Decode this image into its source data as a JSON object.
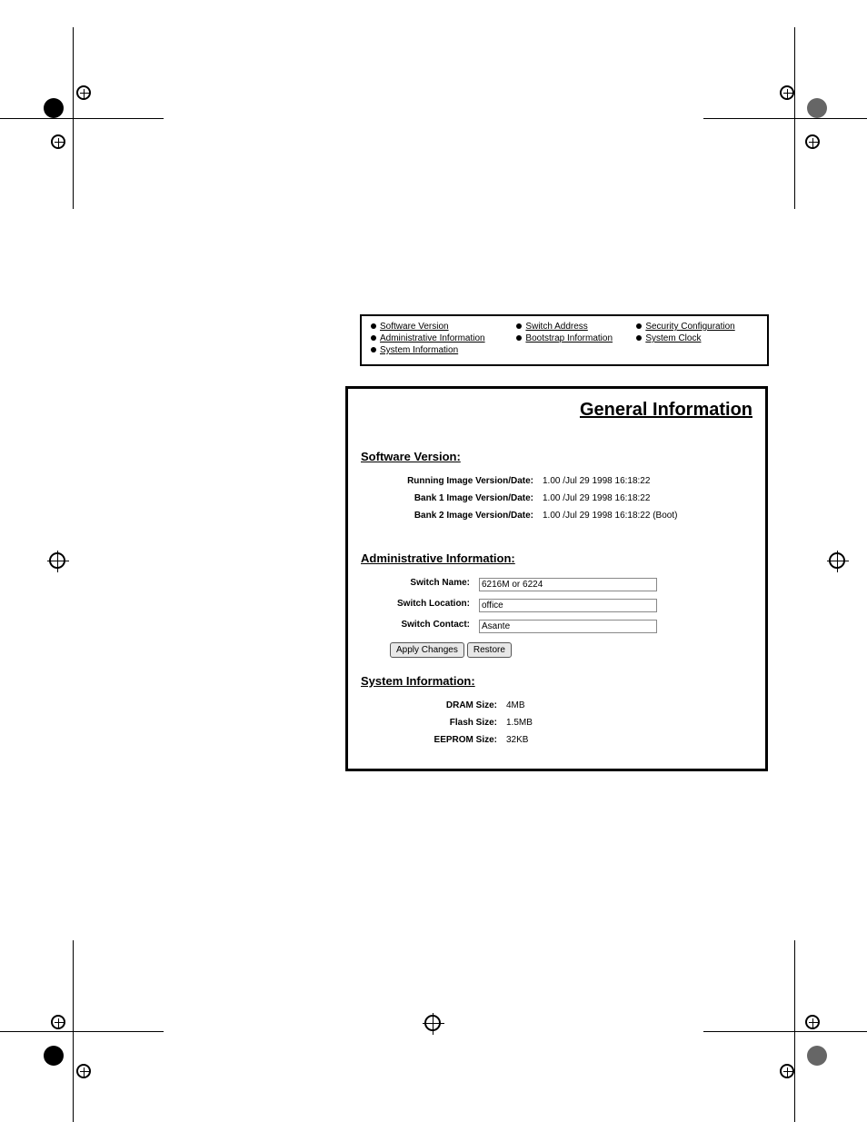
{
  "nav": {
    "col1": [
      "Software Version",
      "Administrative Information",
      "System Information"
    ],
    "col2": [
      "Switch Address",
      "Bootstrap Information"
    ],
    "col3": [
      "Security Configuration",
      "System Clock"
    ]
  },
  "panel": {
    "title": "General Information"
  },
  "software": {
    "heading": "Software Version:",
    "items": [
      {
        "label": "Running Image Version/Date:",
        "value": "1.00 /Jul 29 1998 16:18:22"
      },
      {
        "label": "Bank 1 Image Version/Date:",
        "value": "1.00 /Jul 29 1998 16:18:22"
      },
      {
        "label": "Bank 2 Image Version/Date:",
        "value": "1.00 /Jul 29 1998 16:18:22 (Boot)"
      }
    ]
  },
  "admin": {
    "heading": "Administrative Information:",
    "name_label": "Switch Name:",
    "name_value": "6216M or 6224",
    "location_label": "Switch Location:",
    "location_value": "office",
    "contact_label": "Switch Contact:",
    "contact_value": "Asante",
    "apply": "Apply Changes",
    "restore": "Restore"
  },
  "system": {
    "heading": "System Information:",
    "items": [
      {
        "label": "DRAM Size:",
        "value": "4MB"
      },
      {
        "label": "Flash Size:",
        "value": "1.5MB"
      },
      {
        "label": "EEPROM Size:",
        "value": "32KB"
      }
    ]
  }
}
